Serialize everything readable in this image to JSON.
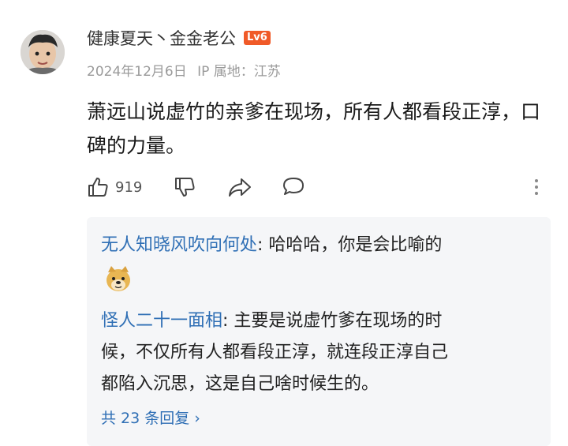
{
  "comment": {
    "username": "健康夏天丶金金老公",
    "level_badge": "Lv6",
    "date": "2024年12月6日",
    "ip_label": "IP 属地：江苏",
    "text": "萧远山说虚竹的亲爹在现场，所有人都看段正淳，口碑的力量。",
    "like_count": "919"
  },
  "replies": [
    {
      "name": "无人知晓风吹向何处",
      "text": ": 哈哈哈，你是会比喻的"
    },
    {
      "name": "怪人二十一面相",
      "text_lines": [
        ": 主要是说虚竹爹在现场的时",
        "候，不仅所有人都看段正淳，就连段正淳自己",
        "都陷入沉思，这是自己啥时候生的。"
      ]
    }
  ],
  "more_replies": "共 23 条回复 ›",
  "icons": {
    "like": "thumbs-up-icon",
    "dislike": "thumbs-down-icon",
    "share": "share-icon",
    "comment": "comment-icon",
    "more": "more-vertical-icon",
    "emoji": "doge-emoji-icon"
  },
  "colors": {
    "badge": "#f05a28",
    "link_blue": "#2f6fb5",
    "reply_bg": "#f5f6f8"
  }
}
